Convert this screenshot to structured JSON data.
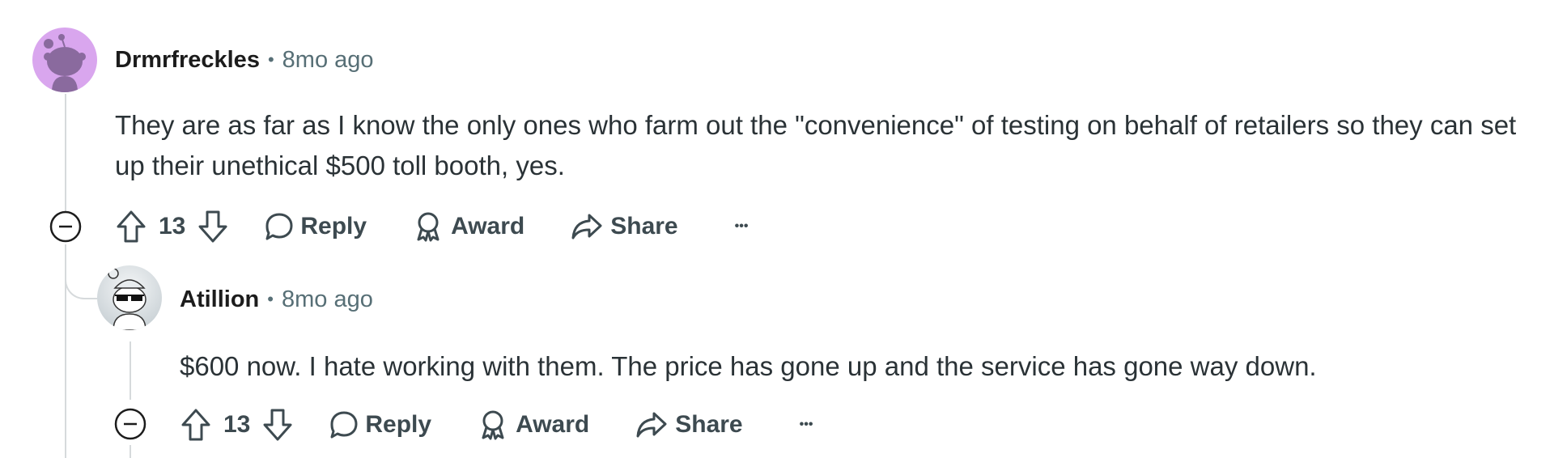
{
  "comments": [
    {
      "username": "Drmrfreckles",
      "separator": "•",
      "time": "8mo ago",
      "body": "They are as far as I know the only ones who farm out the \"convenience\" of testing on behalf of retailers so they can set up their unethical $500 toll booth, yes.",
      "score": "13",
      "actions": {
        "reply": "Reply",
        "award": "Award",
        "share": "Share",
        "more": "•••"
      }
    },
    {
      "username": "Atillion",
      "separator": "•",
      "time": "8mo ago",
      "body": "$600 now. I hate working with them. The price has gone up and the service has gone way down.",
      "score": "13",
      "actions": {
        "reply": "Reply",
        "award": "Award",
        "share": "Share",
        "more": "•••"
      }
    }
  ],
  "colors": {
    "avatar1_bg": "#d9a6ee",
    "thread_line": "#d6dadc",
    "meta_text": "#576f76",
    "action_text": "#3d4a50"
  },
  "icons": [
    "upvote-icon",
    "downvote-icon",
    "reply-icon",
    "award-icon",
    "share-icon",
    "more-icon",
    "collapse-icon",
    "snoo-avatar-icon"
  ]
}
